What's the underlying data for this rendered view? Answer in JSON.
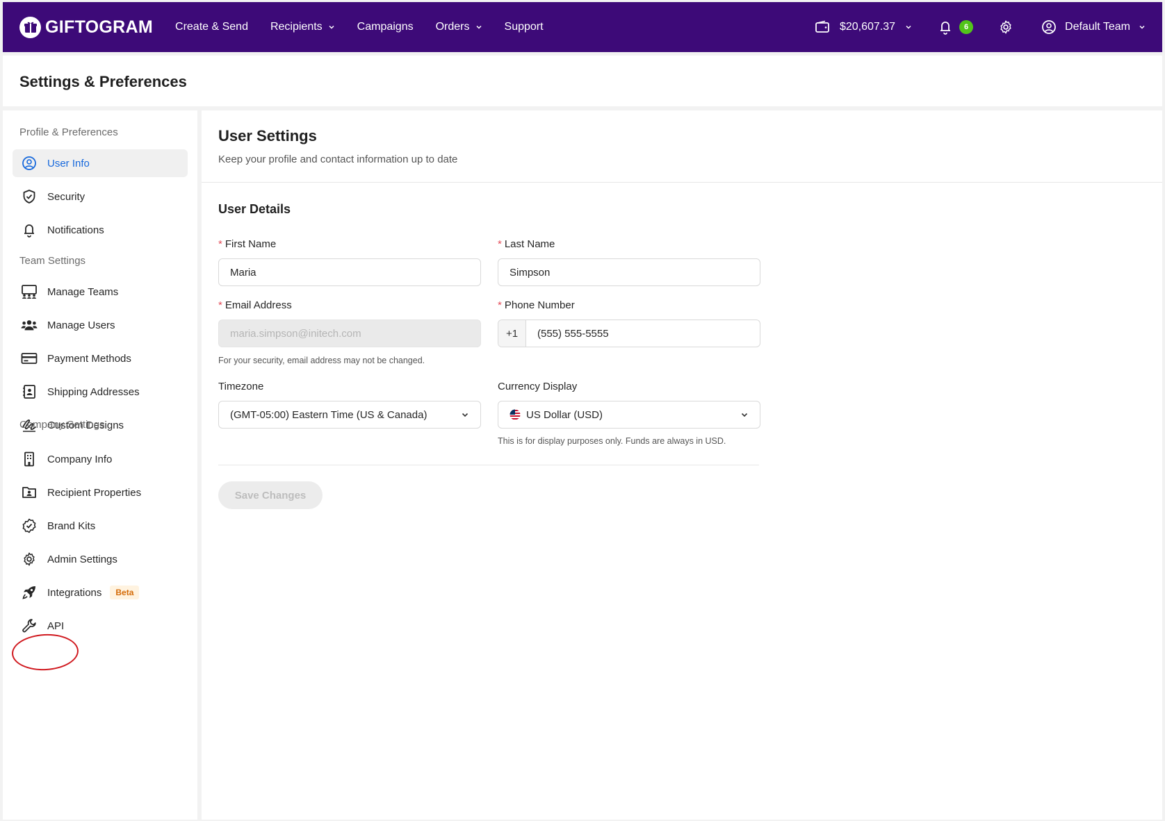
{
  "app": {
    "logo_text": "GIFTOGRAM",
    "nav": [
      "Create & Send",
      "Recipients",
      "Campaigns",
      "Orders",
      "Support"
    ],
    "balance": "$20,607.37",
    "notification_count": "6",
    "team_name": "Default Team",
    "brand_color": "#3d0a78"
  },
  "page": {
    "title": "Settings & Preferences"
  },
  "sidebar": {
    "groups": [
      "Profile & Preferences",
      "Team Settings",
      "Company Settings"
    ],
    "items": [
      {
        "label": "User Info",
        "icon": "user-circle-icon"
      },
      {
        "label": "Security",
        "icon": "shield-check-icon"
      },
      {
        "label": "Notifications",
        "icon": "bell-icon"
      },
      {
        "label": "Manage Teams",
        "icon": "teams-icon"
      },
      {
        "label": "Manage Users",
        "icon": "users-icon"
      },
      {
        "label": "Payment Methods",
        "icon": "credit-card-icon"
      },
      {
        "label": "Shipping Addresses",
        "icon": "address-book-icon"
      },
      {
        "label": "Custom Designs",
        "icon": "signature-icon"
      },
      {
        "label": "Company Info",
        "icon": "building-icon"
      },
      {
        "label": "Recipient Properties",
        "icon": "folder-user-icon"
      },
      {
        "label": "Brand Kits",
        "icon": "badge-check-icon"
      },
      {
        "label": "Admin Settings",
        "icon": "gear-icon"
      },
      {
        "label": "Integrations",
        "icon": "rocket-icon",
        "badge": "Beta"
      },
      {
        "label": "API",
        "icon": "wrench-icon"
      }
    ]
  },
  "main": {
    "title": "User Settings",
    "subtitle": "Keep your profile and contact information up to date",
    "section_title": "User Details",
    "fields": {
      "first_name": {
        "label": "First Name",
        "value": "Maria"
      },
      "last_name": {
        "label": "Last Name",
        "value": "Simpson"
      },
      "email": {
        "label": "Email Address",
        "value": "maria.simpson@initech.com",
        "hint": "For your security, email address may not be changed."
      },
      "phone": {
        "label": "Phone Number",
        "country_code": "+1",
        "value": "(555) 555-5555"
      },
      "timezone": {
        "label": "Timezone",
        "value": "(GMT-05:00) Eastern Time (US & Canada)"
      },
      "currency": {
        "label": "Currency Display",
        "value": "US Dollar (USD)",
        "hint": "This is for display purposes only. Funds are always in USD."
      }
    },
    "save_label": "Save Changes"
  }
}
